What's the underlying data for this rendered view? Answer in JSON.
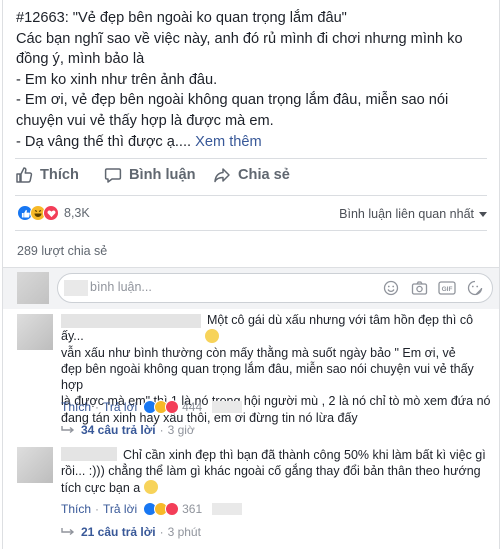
{
  "post": {
    "lines": [
      "#12663: \"Vẻ đẹp bên ngoài ko quan trọng lắm đâu\"",
      "Các bạn nghĩ sao về việc này, anh đó rủ mình đi chơi nhưng mình ko đồng ý, mình bảo là",
      "- Em ko xinh như trên ảnh đâu.",
      "- Em ơi, vẻ đẹp bên ngoài không quan trọng lắm đâu, miễn sao nói chuyện vui vẻ thấy hợp là được mà em.",
      "- Dạ vâng thế thì được ạ...."
    ],
    "see_more": "Xem thêm"
  },
  "actions": {
    "like": "Thích",
    "comment": "Bình luận",
    "share": "Chia sẻ"
  },
  "reactions": {
    "count": "8,3K",
    "icons": [
      "like-reaction-icon",
      "haha-reaction-icon",
      "love-reaction-icon"
    ],
    "colors": {
      "like": "#1877f2",
      "haha": "#f7b928",
      "love": "#f33e58"
    }
  },
  "sort": {
    "label": "Bình luận liên quan nhất"
  },
  "shares": {
    "label": "289 lượt chia sẻ"
  },
  "composer": {
    "placeholder": "bình luận..."
  },
  "comments": [
    {
      "text": "Một cô gái dù xấu nhưng với tâm hồn đẹp thì cô ấy...\nvẫn xấu như bình thường  còn mấy thằng mà suốt ngày bảo \" Em ơi, vẻ\nđẹp bên ngoài không quan trọng lắm đâu, miễn sao nói chuyện vui vẻ thấy hợp\nlà được mà em\" thì 1 là nó trong hội người mù , 2 là nó chỉ tò mò xem đứa nó\nđang tán xinh hay xấu thôi, em ơi đừng tin nó lừa đấy",
      "like": "Thích",
      "reply": "Trả lời",
      "reaction_count": "444",
      "replies": "34 câu trả lời",
      "time": "3 giờ"
    },
    {
      "text": "Chỉ cần xinh đẹp thì bạn đã thành công 50% khi làm bất kì việc gì\nrồi... :))) chẳng thể làm gì khác ngoài cố gắng thay đổi bản thân theo hướng\ntích cực bạn a ",
      "like": "Thích",
      "reply": "Trả lời",
      "reaction_count": "361",
      "replies": "21 câu trả lời",
      "time": "3 phút"
    }
  ],
  "separator": "·"
}
